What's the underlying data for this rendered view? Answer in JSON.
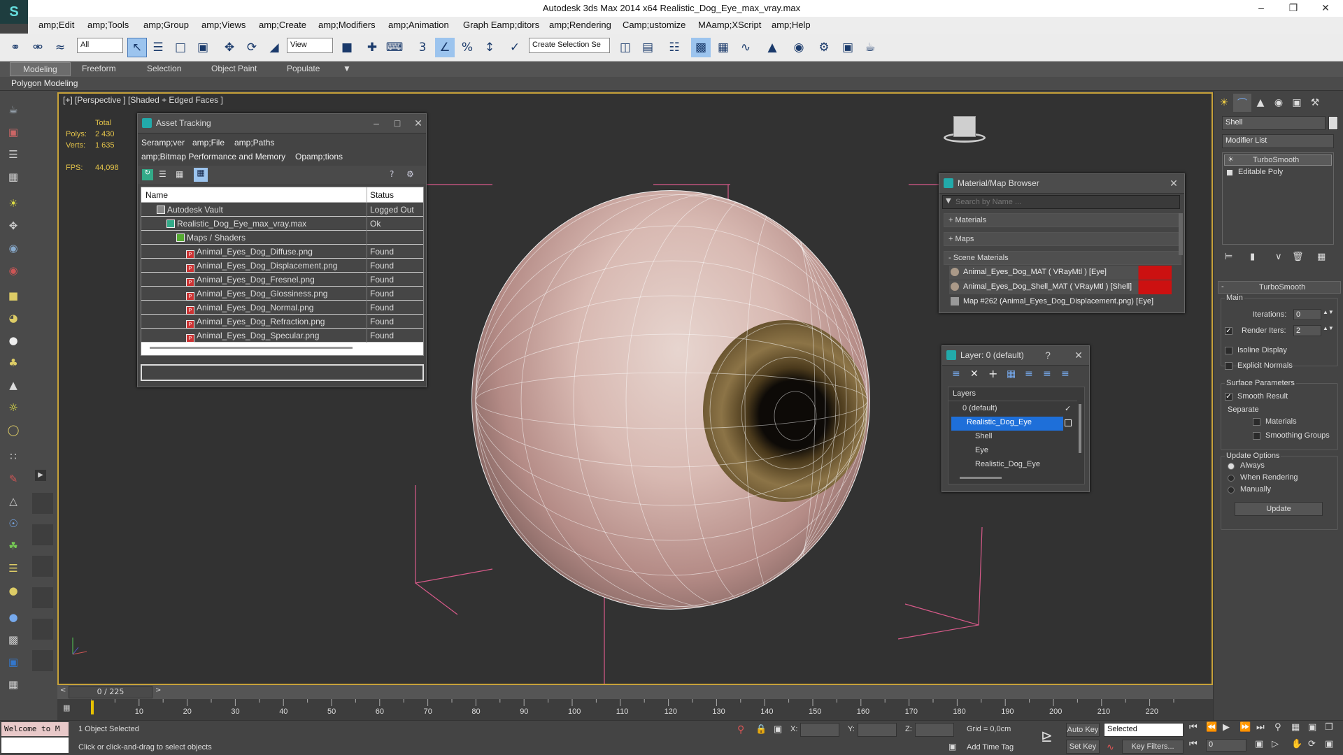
{
  "window": {
    "title": "Autodesk 3ds Max  2014 x64     Realistic_Dog_Eye_max_vray.max"
  },
  "menu": [
    "amp;Edit",
    "amp;Tools",
    "amp;Group",
    "amp;Views",
    "amp;Create",
    "amp;Modifiers",
    "amp;Animation",
    "Graph Eamp;ditors",
    "amp;Rendering",
    "Camp;ustomize",
    "MAamp;XScript",
    "amp;Help"
  ],
  "toolbar": {
    "filter": "All",
    "refcoord": "View",
    "selection_set": "Create Selection Se"
  },
  "ribbon": {
    "tabs": [
      "Modeling",
      "Freeform",
      "Selection",
      "Object Paint",
      "Populate"
    ],
    "sub": "Polygon Modeling"
  },
  "viewport": {
    "label": "[+] [Perspective ] [Shaded + Edged Faces ]",
    "stats": {
      "total": "Total",
      "polys_label": "Polys:",
      "polys": "2 430",
      "verts_label": "Verts:",
      "verts": "1 635",
      "fps_label": "FPS:",
      "fps": "44,098"
    }
  },
  "asset_tracking": {
    "title": "Asset Tracking",
    "menu": [
      "Seramp;ver",
      "amp;File",
      "amp;Paths",
      "amp;Bitmap Performance and Memory",
      "Opamp;tions"
    ],
    "col_name": "Name",
    "col_status": "Status",
    "rows": [
      {
        "name": "Autodesk Vault",
        "status": "Logged Out ..."
      },
      {
        "name": "Realistic_Dog_Eye_max_vray.max",
        "status": "Ok"
      },
      {
        "name": "Maps / Shaders",
        "status": ""
      },
      {
        "name": "Animal_Eyes_Dog_Diffuse.png",
        "status": "Found"
      },
      {
        "name": "Animal_Eyes_Dog_Displacement.png",
        "status": "Found"
      },
      {
        "name": "Animal_Eyes_Dog_Fresnel.png",
        "status": "Found"
      },
      {
        "name": "Animal_Eyes_Dog_Glossiness.png",
        "status": "Found"
      },
      {
        "name": "Animal_Eyes_Dog_Normal.png",
        "status": "Found"
      },
      {
        "name": "Animal_Eyes_Dog_Refraction.png",
        "status": "Found"
      },
      {
        "name": "Animal_Eyes_Dog_Specular.png",
        "status": "Found"
      }
    ]
  },
  "material_browser": {
    "title": "Material/Map Browser",
    "search_placeholder": "Search by Name ...",
    "sections": [
      "+ Materials",
      "+ Maps",
      "- Scene Materials"
    ],
    "items": [
      "Animal_Eyes_Dog_MAT  ( VRayMtl )  [Eye]",
      "Animal_Eyes_Dog_Shell_MAT  ( VRayMtl )  [Shell]",
      "Map #262 (Animal_Eyes_Dog_Displacement.png)  [Eye]"
    ]
  },
  "layer": {
    "title": "Layer: 0 (default)",
    "help": "?",
    "header": "Layers",
    "rows": [
      "0 (default)",
      "Realistic_Dog_Eye",
      "Shell",
      "Eye",
      "Realistic_Dog_Eye"
    ]
  },
  "command_panel": {
    "object_name": "Shell",
    "modifier_list": "Modifier List",
    "stack": [
      "TurboSmooth",
      "Editable Poly"
    ],
    "rollout": "TurboSmooth",
    "main": "Main",
    "iterations_label": "Iterations:",
    "iterations": "0",
    "render_iters_label": "Render Iters:",
    "render_iters": "2",
    "isoline": "Isoline Display",
    "explicit": "Explicit Normals",
    "surface": "Surface Parameters",
    "smooth": "Smooth Result",
    "separate": "Separate",
    "materials": "Materials",
    "smoothing_groups": "Smoothing Groups",
    "update_options": "Update Options",
    "always": "Always",
    "when_rendering": "When Rendering",
    "manually": "Manually",
    "update": "Update"
  },
  "timeline": {
    "frame": "0 / 225",
    "ticks": [
      "10",
      "20",
      "30",
      "40",
      "50",
      "60",
      "70",
      "80",
      "90",
      "100",
      "110",
      "120",
      "130",
      "140",
      "150",
      "160",
      "170",
      "180",
      "190",
      "200",
      "210",
      "220"
    ]
  },
  "status": {
    "maxscript": "Welcome to M",
    "selected": "1 Object Selected",
    "prompt": "Click or click-and-drag to select objects",
    "x": "X:",
    "y": "Y:",
    "z": "Z:",
    "grid": "Grid = 0,0cm",
    "add_time_tag": "Add Time Tag",
    "auto_key": "Auto Key",
    "set_key": "Set Key",
    "selected_dd": "Selected",
    "key_filters": "Key Filters...",
    "frame_field": "0"
  }
}
